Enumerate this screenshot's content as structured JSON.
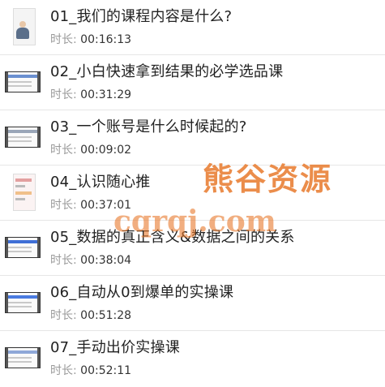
{
  "duration_label": "时长:",
  "courses": [
    {
      "title": "01_我们的课程内容是什么?",
      "duration": "00:16:13",
      "thumb": "portrait"
    },
    {
      "title": "02_小白快速拿到结果的必学选品课",
      "duration": "00:31:29",
      "thumb": "wide"
    },
    {
      "title": "03_一个账号是什么时候起的?",
      "duration": "00:09:02",
      "thumb": "wide"
    },
    {
      "title": "04_认识随心推",
      "duration": "00:37:01",
      "thumb": "tall"
    },
    {
      "title": "05_数据的真正含义&数据之间的关系",
      "duration": "00:38:04",
      "thumb": "wide"
    },
    {
      "title": "06_自动从0到爆单的实操课",
      "duration": "00:51:28",
      "thumb": "wide"
    },
    {
      "title": "07_手动出价实操课",
      "duration": "00:52:11",
      "thumb": "wide"
    }
  ],
  "watermark": {
    "brand": "熊谷资源",
    "site": "cqrqj.com"
  }
}
